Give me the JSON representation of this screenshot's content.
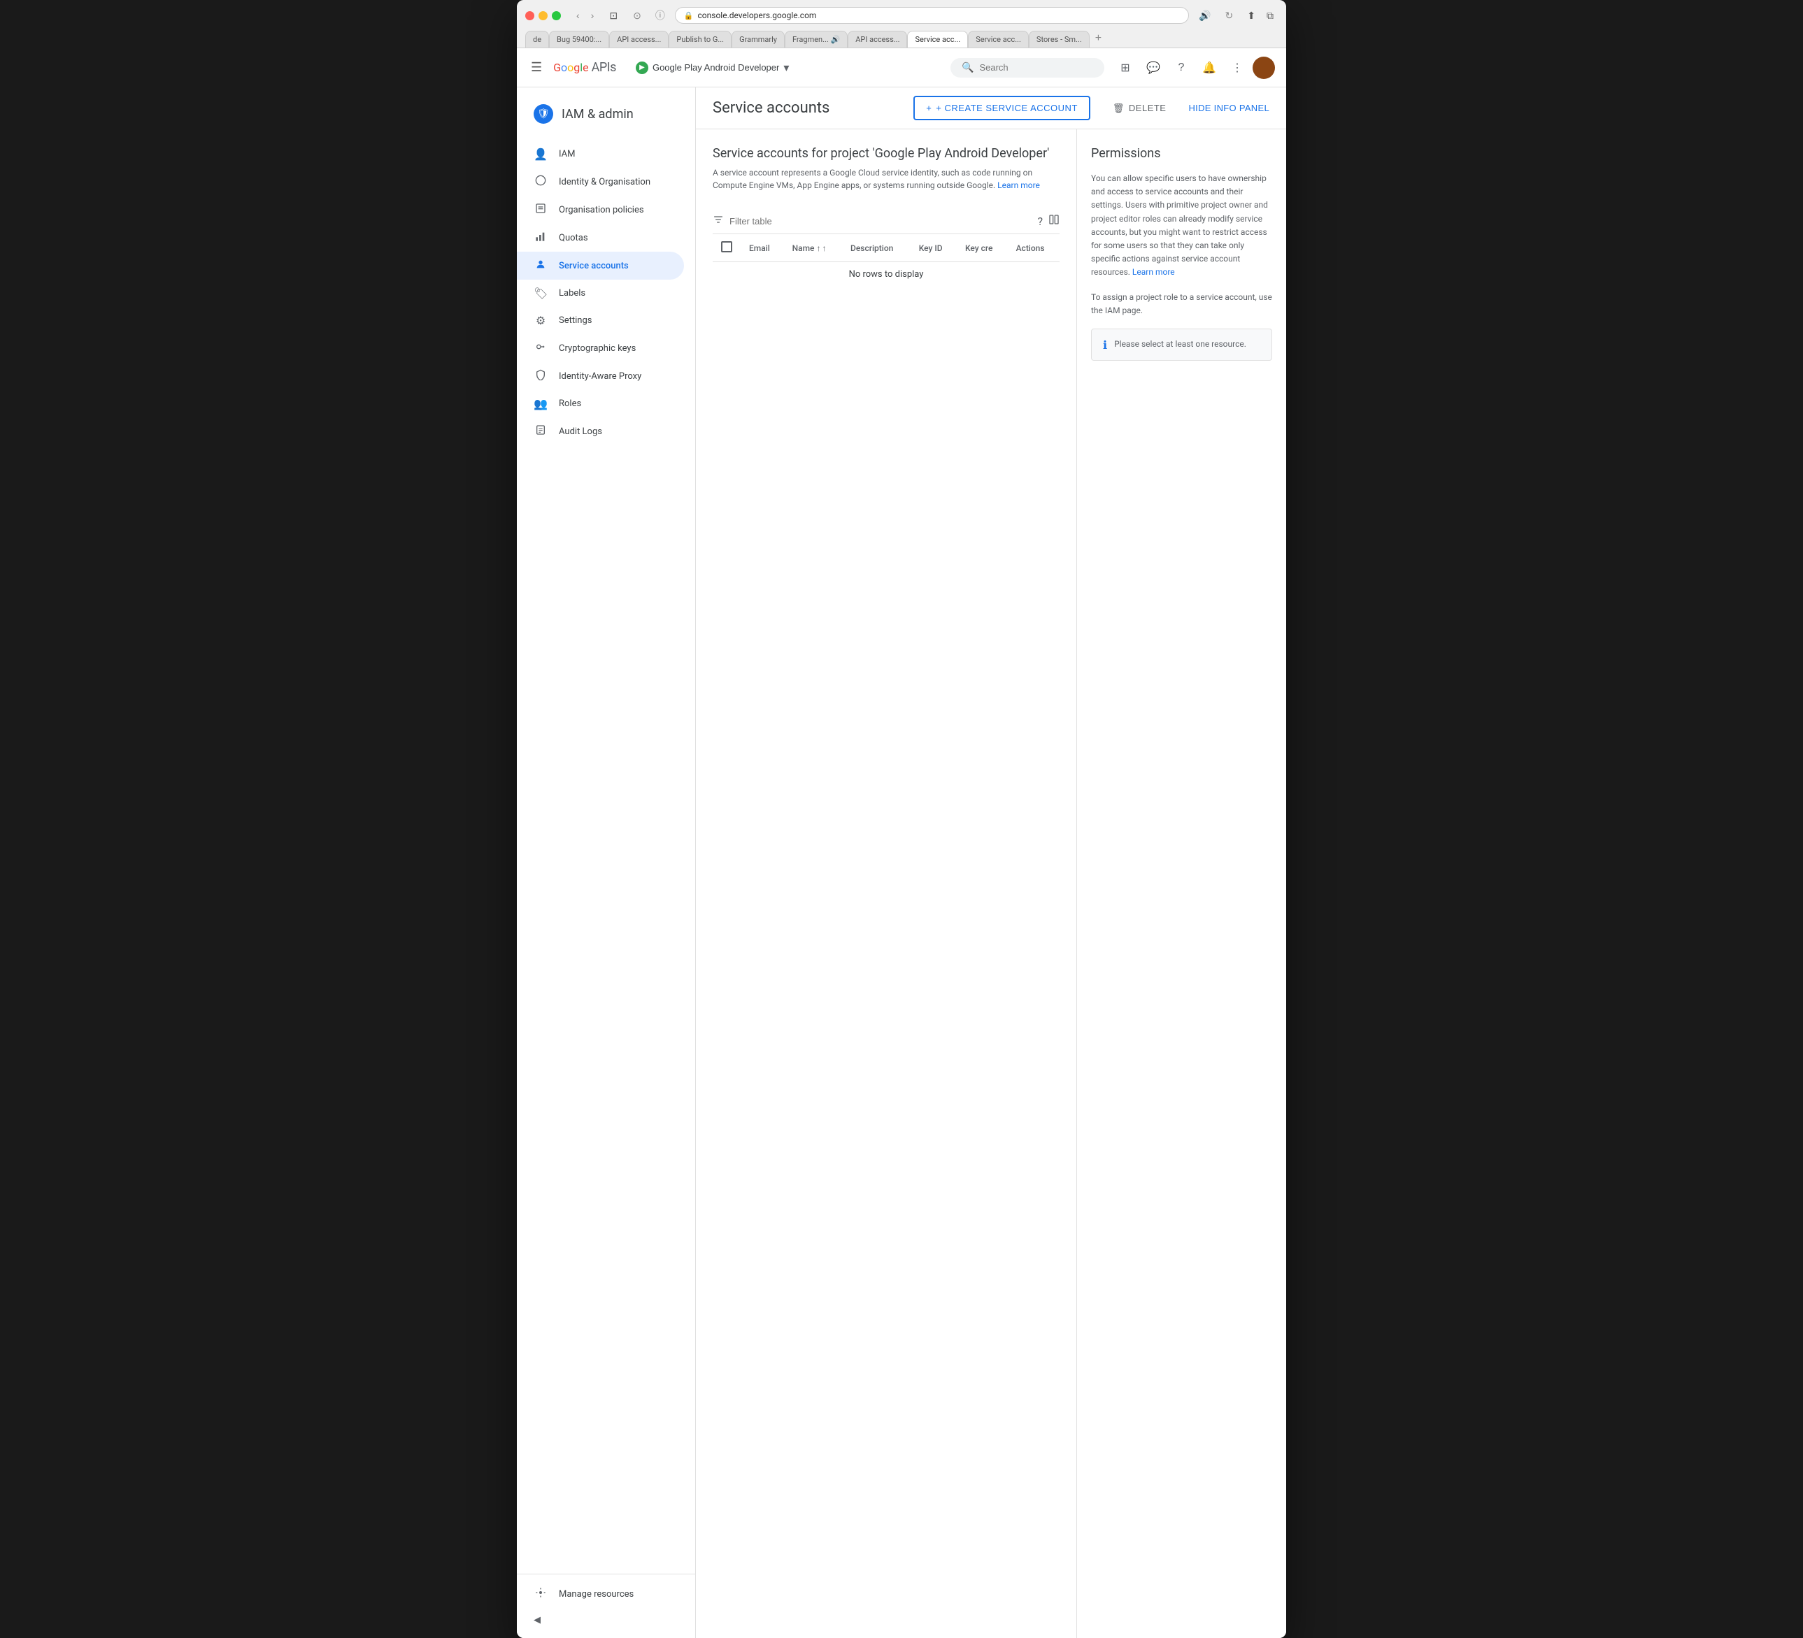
{
  "browser": {
    "url": "console.developers.google.com",
    "tabs": [
      {
        "id": "tab-de",
        "label": "de"
      },
      {
        "id": "tab-bug",
        "label": "Bug 59400:..."
      },
      {
        "id": "tab-api1",
        "label": "API access..."
      },
      {
        "id": "tab-publish",
        "label": "Publish to G..."
      },
      {
        "id": "tab-grammarly",
        "label": "Grammarly"
      },
      {
        "id": "tab-fragment",
        "label": "Fragmen... 🔊"
      },
      {
        "id": "tab-api2",
        "label": "API access..."
      },
      {
        "id": "tab-service1",
        "label": "Service acc...",
        "active": true
      },
      {
        "id": "tab-service2",
        "label": "Service acc..."
      },
      {
        "id": "tab-stores",
        "label": "Stores - Sm..."
      }
    ]
  },
  "topnav": {
    "search_placeholder": "Search",
    "project_name": "Google Play Android Developer",
    "icons": {
      "hamburger": "☰",
      "search": "🔍",
      "apps": "⊞",
      "support": "❓",
      "help": "?",
      "notifications": "🔔",
      "more": "⋮"
    }
  },
  "sidebar": {
    "header_title": "IAM & admin",
    "items": [
      {
        "id": "iam",
        "label": "IAM",
        "icon": "👤"
      },
      {
        "id": "identity-org",
        "label": "Identity & Organisation",
        "icon": "🔵"
      },
      {
        "id": "org-policies",
        "label": "Organisation policies",
        "icon": "📋"
      },
      {
        "id": "quotas",
        "label": "Quotas",
        "icon": "📊"
      },
      {
        "id": "service-accounts",
        "label": "Service accounts",
        "icon": "🔑",
        "active": true
      },
      {
        "id": "labels",
        "label": "Labels",
        "icon": "🏷"
      },
      {
        "id": "settings",
        "label": "Settings",
        "icon": "⚙"
      },
      {
        "id": "crypto-keys",
        "label": "Cryptographic keys",
        "icon": "🔐"
      },
      {
        "id": "identity-proxy",
        "label": "Identity-Aware Proxy",
        "icon": "🛡"
      },
      {
        "id": "roles",
        "label": "Roles",
        "icon": "👥"
      },
      {
        "id": "audit-logs",
        "label": "Audit Logs",
        "icon": "📄"
      }
    ],
    "bottom": {
      "manage_resources": "Manage resources",
      "collapse": "◀"
    }
  },
  "main": {
    "page_title": "Service accounts",
    "create_button": "+ CREATE SERVICE ACCOUNT",
    "delete_button": "DELETE",
    "hide_panel_button": "HIDE INFO PANEL",
    "service_accounts_heading": "Service accounts for project 'Google Play Android Developer'",
    "service_accounts_desc": "A service account represents a Google Cloud service identity, such as code running on Compute Engine VMs, App Engine apps, or systems running outside Google.",
    "learn_more_link": "Learn more",
    "filter_placeholder": "Filter table",
    "table": {
      "columns": [
        "Email",
        "Name ↑",
        "Description",
        "Key ID",
        "Key cre",
        "Actions"
      ],
      "no_rows_message": "No rows to display"
    }
  },
  "permissions": {
    "title": "Permissions",
    "description": "You can allow specific users to have ownership and access to service accounts and their settings. Users with primitive project owner and project editor roles can already modify service accounts, but you might want to restrict access for some users so that they can take only specific actions against service account resources.",
    "learn_more_link": "Learn more",
    "iam_note": "To assign a project role to a service account, use the IAM page.",
    "info_message": "Please select at least one resource."
  }
}
